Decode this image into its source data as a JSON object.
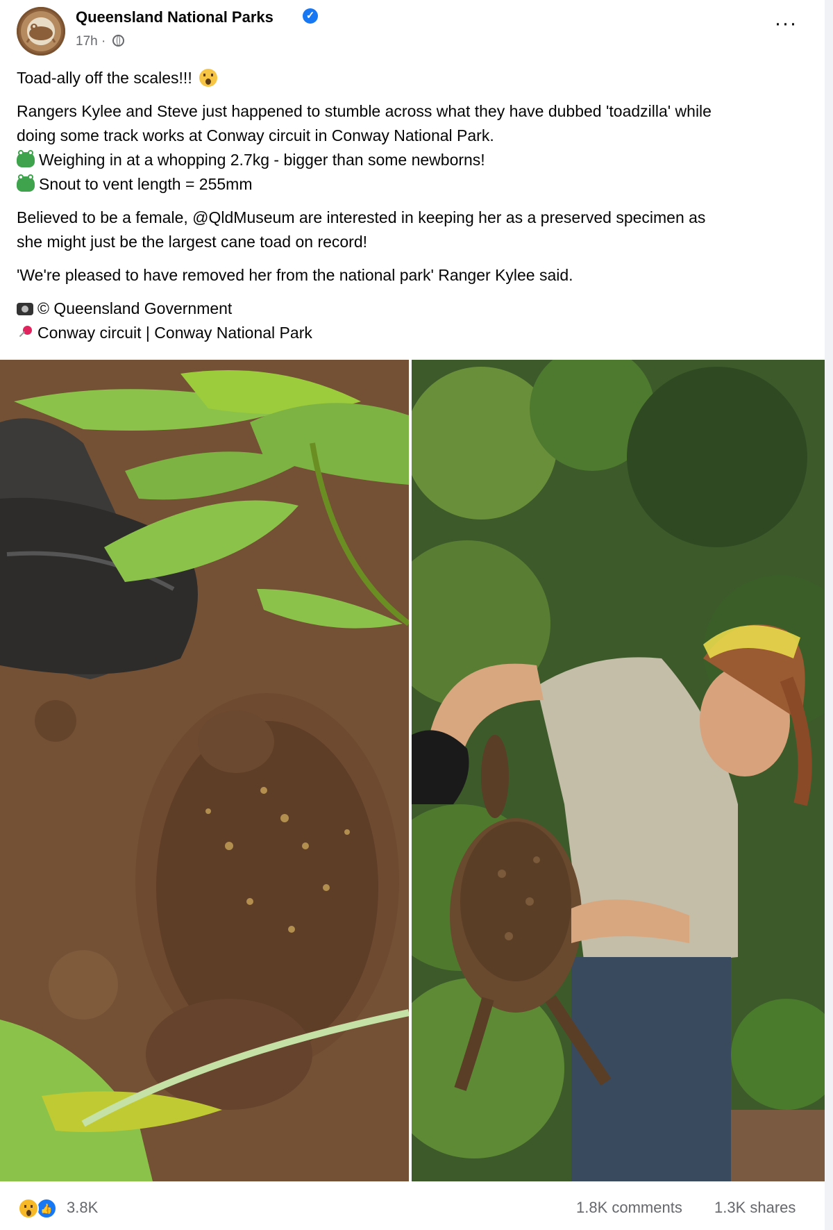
{
  "header": {
    "page_name": "Queensland National Parks",
    "timestamp": "17h ·",
    "verified_icon": "verified-badge-icon",
    "globe_icon": "globe-icon",
    "more_label": "···"
  },
  "post": {
    "headline": "Toad-ally off the scales!!!",
    "paragraph1_line1": "Rangers Kylee and Steve just happened to stumble across what they have dubbed 'toadzilla' while",
    "paragraph1_line2": "doing some track works at Conway circuit in Conway National Park.",
    "fact1": "Weighing in at a whopping 2.7kg - bigger than some newborns!",
    "fact2": "Snout to vent length = 255mm",
    "paragraph2_line1": "Believed to be a female, @QldMuseum are interested in keeping her as a preserved specimen as",
    "paragraph2_line2": "she might just be the largest cane toad on record!",
    "quote": "'We're pleased to have removed her from the national park' Ranger Kylee said.",
    "credit": "© Queensland Government",
    "location": "Conway circuit | Conway National Park"
  },
  "photos": [
    {
      "name": "photo-toad-on-ground"
    },
    {
      "name": "photo-ranger-holding-toad"
    }
  ],
  "footer": {
    "reaction_count": "3.8K",
    "comments": "1.8K comments",
    "shares": "1.3K shares"
  },
  "colors": {
    "text_primary": "#050505",
    "text_secondary": "#65676b",
    "verified_blue": "#1877f2",
    "frame_bg": "#f0f2f5"
  }
}
